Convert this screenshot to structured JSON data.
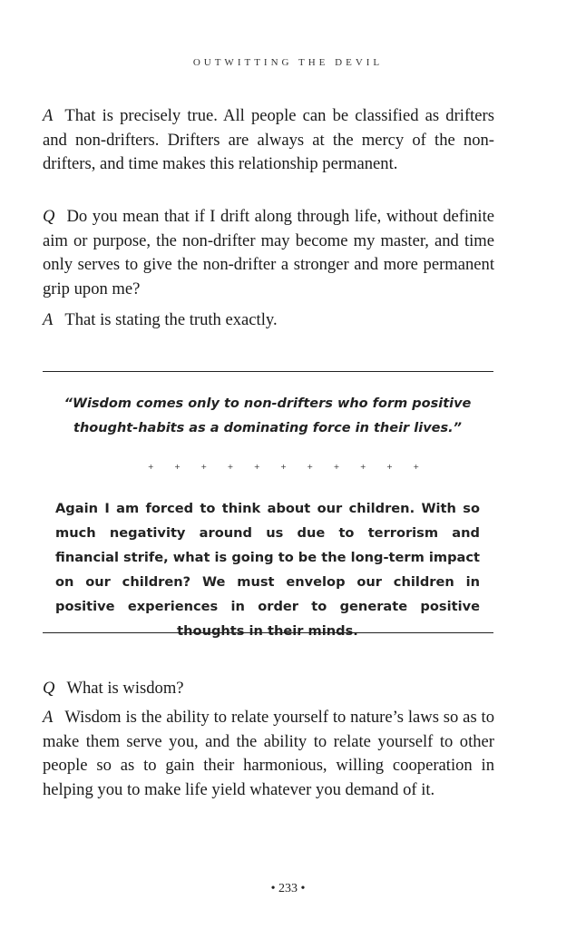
{
  "running_head": "OUTWITTING THE DEVIL",
  "dialogue_1": [
    {
      "marker": "A",
      "text": "That is precisely true. All people can be classified as drifters and non-drifters. Drifters are always at the mercy of the non-drifters, and time makes this relationship permanent."
    },
    {
      "marker": "Q",
      "text": "Do you mean that if I drift along through life, without definite aim or purpose, the non-drifter may become my master, and time only serves to give the non-drifter a stronger and more permanent grip upon me?"
    },
    {
      "marker": "A",
      "text": "That is stating the truth exactly."
    }
  ],
  "callout": {
    "quote": "“Wisdom comes only to non-drifters who form positive thought-habits as a dominating force in their lives.”",
    "ornament": "+ + + + + + + + + + +",
    "commentary": "Again I am forced to think about our children. With so much negativity around us due to terrorism and financial strife, what is going to be the long-term impact on our children? We must envelop our children in positive experiences in order to generate positive thoughts in their minds."
  },
  "dialogue_2": [
    {
      "marker": "Q",
      "text": "What is wisdom?"
    },
    {
      "marker": "A",
      "text": "Wisdom is the ability to relate yourself to nature’s laws so as to make them serve you, and the ability to relate yourself to other people so as to gain their harmonious, willing cooperation in helping you to make life yield whatever you demand of it."
    }
  ],
  "folio": "• 233 •"
}
